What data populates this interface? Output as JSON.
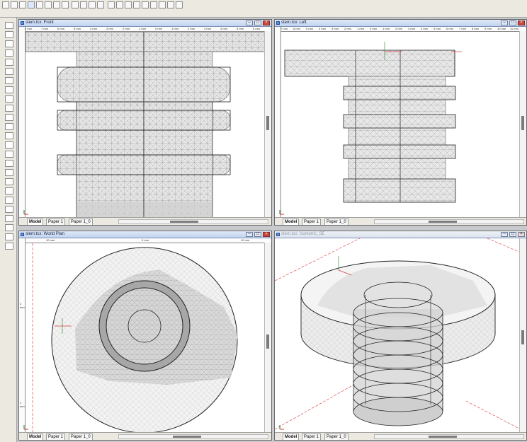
{
  "colors": {
    "window_bg": "#ffffff",
    "mesh": "#8e8e8e",
    "title_bar": "#c0d3f0",
    "close_button": "#c8493b",
    "guide_line": "#e24d4d"
  },
  "views": {
    "front": {
      "title": "stem.tcx: Front",
      "ruler_labels": [
        "8 mm",
        "7 mm",
        "6 mm",
        "5 mm",
        "4 mm",
        "3 mm",
        "2 mm",
        "1 mm",
        "0 mm",
        "1 mm",
        "2 mm",
        "3 mm",
        "4 mm",
        "5 mm",
        "6 mm",
        "7 mm"
      ]
    },
    "left": {
      "title": "stem.tcx: Left",
      "ruler_labels": [
        "7 mm",
        "6 mm",
        "5 mm",
        "4 mm",
        "3 mm",
        "2 mm",
        "1 mm",
        "0 mm",
        "1 mm",
        "2 mm",
        "3 mm",
        "4 mm",
        "5 mm",
        "6 mm",
        "7 mm",
        "8 mm",
        "9 mm",
        "10 mm",
        "11 mm"
      ]
    },
    "plan": {
      "title": "stem.tcx: World Plan",
      "ruler_labels": [
        "10 mm",
        "0 mm",
        "10 mm"
      ],
      "side_labels": [
        "2 mm",
        "1 mm"
      ]
    },
    "iso": {
      "title": "stem.tcx: Isometric_SE"
    }
  },
  "tabs": {
    "model": "Model",
    "paper1": "Paper 1",
    "paper1_0": "Paper 1_0"
  },
  "buttons": {
    "minimize": "–",
    "maximize": "□",
    "close": "×"
  }
}
